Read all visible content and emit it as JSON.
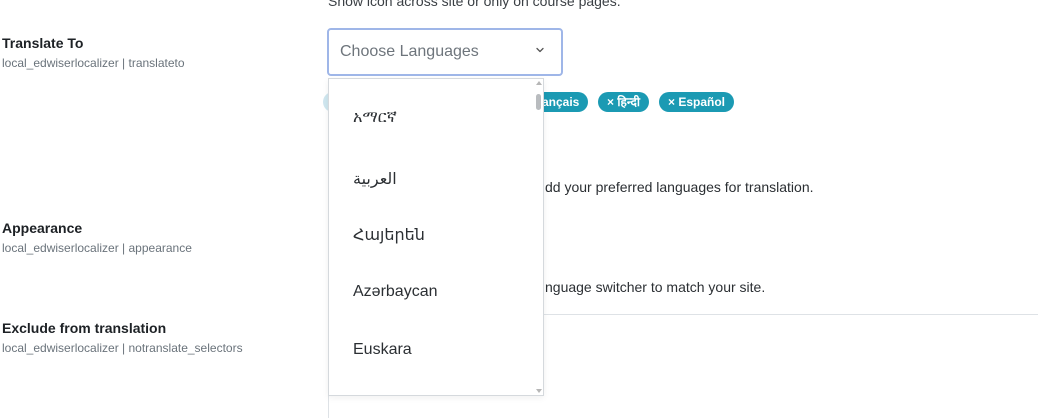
{
  "top_description": "Show icon across site or only on course pages.",
  "settings": [
    {
      "title": "Translate To",
      "key": "local_edwiserlocalizer | translateto"
    },
    {
      "title": "Appearance",
      "key": "local_edwiserlocalizer | appearance"
    },
    {
      "title": "Exclude from translation",
      "key": "local_edwiserlocalizer | notranslate_selectors"
    }
  ],
  "translate_to": {
    "placeholder": "Choose Languages",
    "chevron_icon": "chevron-down-icon",
    "selected_tags": [
      "ançais",
      "× हिन्दी",
      "× Español"
    ],
    "help_text": "dd your preferred languages for translation."
  },
  "appearance": {
    "help_text": "nguage switcher to match your site."
  },
  "dropdown": {
    "options": [
      "አማርኛ",
      "العربية",
      "Հայերեն",
      "Azərbaycan",
      "Euskara"
    ]
  },
  "colors": {
    "tag_bg": "#1b9ab3",
    "focus_border": "#9fb6e8"
  }
}
